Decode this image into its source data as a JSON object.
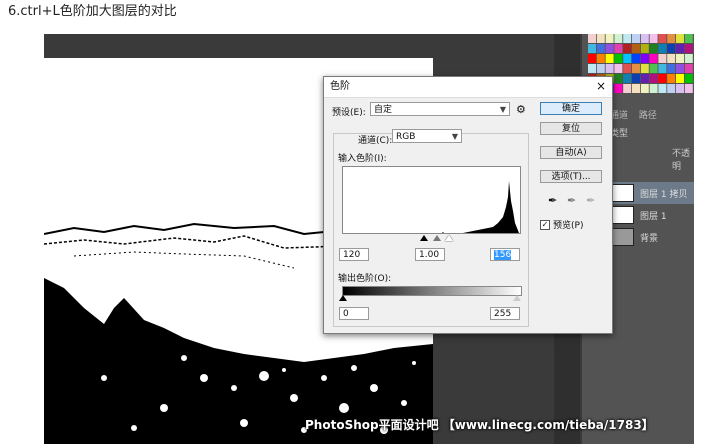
{
  "caption": "6.ctrl+L色阶加大图层的对比",
  "dialog": {
    "title": "色阶",
    "close": "×",
    "preset_label": "预设(E):",
    "preset_value": "自定",
    "channel_label": "通道(C):",
    "channel_value": "RGB",
    "input_label": "输入色阶(I):",
    "input_black": "120",
    "input_mid": "1.00",
    "input_white": "156",
    "output_label": "输出色阶(O):",
    "output_black": "0",
    "output_white": "255",
    "buttons": {
      "ok": "确定",
      "reset": "复位",
      "auto": "自动(A)",
      "options": "选项(T)..."
    },
    "preview_label": "预览(P)",
    "preview_checked": "✓",
    "gear": "⚙"
  },
  "layers_panel": {
    "tabs": [
      "通道",
      "路径"
    ],
    "kind_label": "类型",
    "opacity_label": "不透明",
    "layers": [
      {
        "name": "图层 1 拷贝",
        "selected": true
      },
      {
        "name": "图层 1",
        "selected": false
      },
      {
        "name": "背景",
        "selected": false
      }
    ]
  },
  "watermark": "PhotoShop平面设计吧 【www.linecg.com/tieba/1783】",
  "colors": {
    "accent": "#3c7fb1",
    "workspace": "#3a3a3a",
    "panel": "#535353"
  }
}
